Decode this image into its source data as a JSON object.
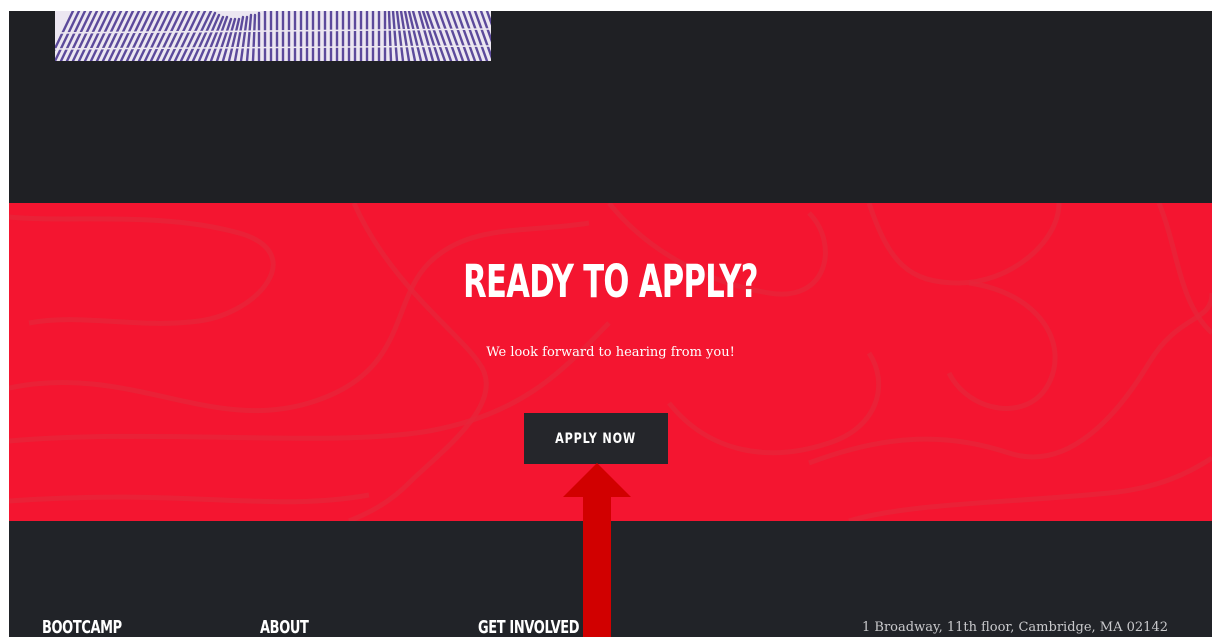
{
  "cta": {
    "title": "READY TO APPLY?",
    "subtitle": "We look forward to hearing from you!",
    "button_label": "APPLY NOW"
  },
  "footer": {
    "columns": [
      {
        "heading": "BOOTCAMP"
      },
      {
        "heading": "ABOUT"
      },
      {
        "heading": "GET INVOLVED"
      }
    ],
    "address": "1 Broadway, 11th floor, Cambridge, MA 02142"
  },
  "colors": {
    "dark_background": "#1f2024",
    "cta_red": "#f41530",
    "button_dark": "#25262b",
    "arrow_red": "#d10000"
  },
  "icons": {
    "annotation": "arrow-up-icon"
  }
}
